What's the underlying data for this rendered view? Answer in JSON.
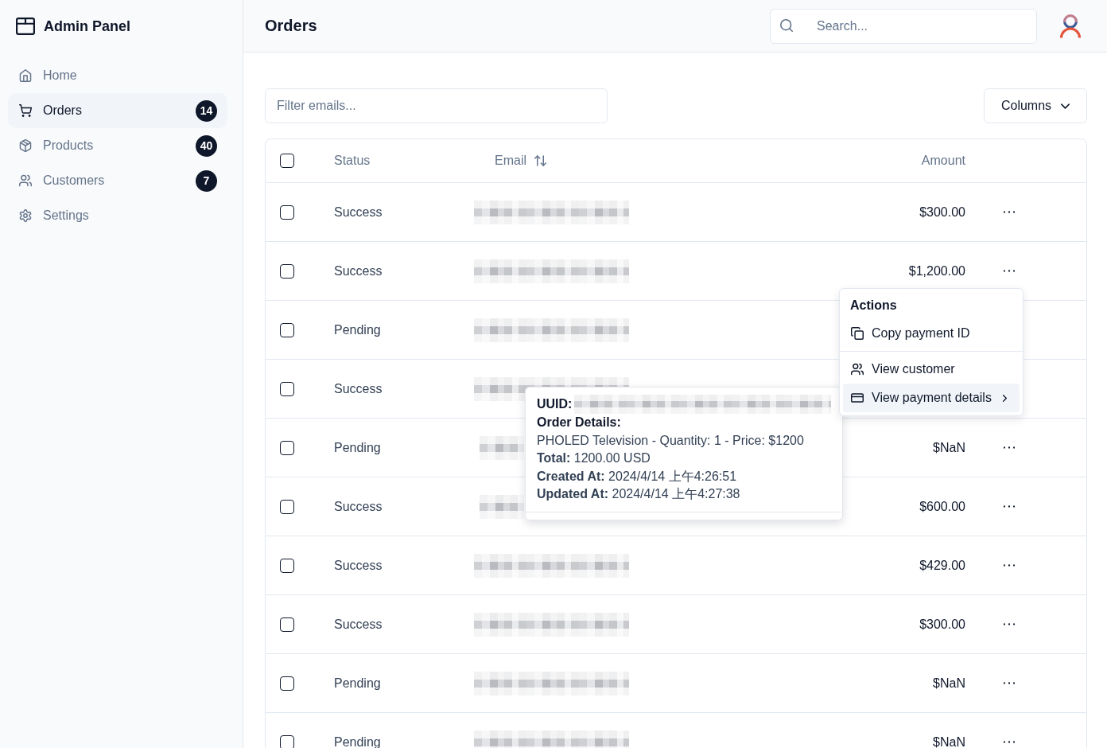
{
  "sidebar": {
    "brand": "Admin Panel",
    "items": [
      {
        "label": "Home",
        "selected": false
      },
      {
        "label": "Orders",
        "badge": "14",
        "selected": true
      },
      {
        "label": "Products",
        "badge": "40",
        "selected": false
      },
      {
        "label": "Customers",
        "badge": "7",
        "selected": false
      },
      {
        "label": "Settings",
        "selected": false
      }
    ]
  },
  "header": {
    "title": "Orders",
    "search": {
      "placeholder": "Search..."
    }
  },
  "toolbar": {
    "filter": {
      "placeholder": "Filter emails..."
    },
    "columns_button": "Columns"
  },
  "table": {
    "select_all": {
      "checked": false
    },
    "columns": [
      {
        "label": "Status",
        "sortable": false
      },
      {
        "label": "Email",
        "sortable": true
      },
      {
        "label": "Amount",
        "sortable": false
      }
    ],
    "rows": [
      {
        "checked": false,
        "status": "Success",
        "email": {
          "kind": "redacted"
        },
        "amount": "$300.00"
      },
      {
        "checked": false,
        "status": "Success",
        "email": {
          "kind": "redacted"
        },
        "amount": "$1,200.00"
      },
      {
        "checked": false,
        "status": "Pending",
        "email": {
          "kind": "redacted"
        }
      },
      {
        "checked": false,
        "status": "Success",
        "email": {
          "kind": "redacted"
        }
      },
      {
        "checked": false,
        "status": "Pending",
        "email": {
          "kind": "redacted_partial"
        },
        "amount": "$NaN"
      },
      {
        "checked": false,
        "status": "Success",
        "email": {
          "kind": "redacted_partial"
        },
        "amount": "$600.00"
      },
      {
        "checked": false,
        "status": "Success",
        "email": {
          "kind": "redacted"
        },
        "amount": "$429.00"
      },
      {
        "checked": false,
        "status": "Success",
        "email": {
          "kind": "redacted"
        },
        "amount": "$300.00"
      },
      {
        "checked": false,
        "status": "Pending",
        "email": {
          "kind": "redacted"
        },
        "amount": "$NaN"
      },
      {
        "checked": false,
        "status": "Pending",
        "email": {
          "kind": "redacted"
        },
        "amount": "$NaN"
      }
    ]
  },
  "actions_menu": {
    "label": "Actions",
    "items": [
      {
        "kind": "item",
        "label": "Copy payment ID",
        "selected": false,
        "submenu": false
      },
      {
        "kind": "separator"
      },
      {
        "kind": "item",
        "label": "View customer",
        "selected": false,
        "submenu": false
      },
      {
        "kind": "item",
        "label": "View payment details",
        "selected": true,
        "submenu": true
      }
    ]
  },
  "details_popover": {
    "uuid_label": "UUID:",
    "uuid": {
      "kind": "redacted"
    },
    "heading": "Order Details:",
    "lines": [
      "PHOLED Television - Quantity: 1 - Price: $1200",
      "**Total:** 1200.00 USD",
      "**Created At:** 2024/4/14 上午4:26:51",
      "**Updated At:** 2024/4/14 上午4:27:38"
    ]
  }
}
